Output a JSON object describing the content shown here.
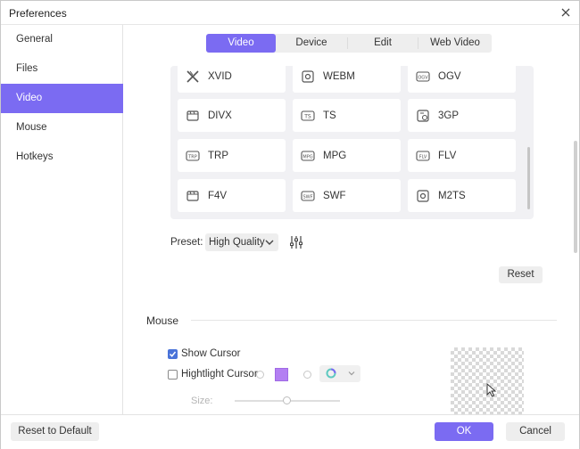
{
  "window": {
    "title": "Preferences"
  },
  "sidebar": {
    "items": [
      {
        "label": "General"
      },
      {
        "label": "Files"
      },
      {
        "label": "Video"
      },
      {
        "label": "Mouse"
      },
      {
        "label": "Hotkeys"
      }
    ],
    "active": "Video"
  },
  "tabs": {
    "items": [
      {
        "label": "Video"
      },
      {
        "label": "Device"
      },
      {
        "label": "Edit"
      },
      {
        "label": "Web Video"
      }
    ],
    "active": "Video"
  },
  "formats": [
    {
      "label": "XVID",
      "icon": "xvid-icon"
    },
    {
      "label": "WEBM",
      "icon": "webm-icon"
    },
    {
      "label": "OGV",
      "icon": "ogv-icon"
    },
    {
      "label": "DIVX",
      "icon": "divx-icon"
    },
    {
      "label": "TS",
      "icon": "ts-icon"
    },
    {
      "label": "3GP",
      "icon": "3gp-icon"
    },
    {
      "label": "TRP",
      "icon": "trp-icon"
    },
    {
      "label": "MPG",
      "icon": "mpg-icon"
    },
    {
      "label": "FLV",
      "icon": "flv-icon"
    },
    {
      "label": "F4V",
      "icon": "f4v-icon"
    },
    {
      "label": "SWF",
      "icon": "swf-icon"
    },
    {
      "label": "M2TS",
      "icon": "m2ts-icon"
    }
  ],
  "preset": {
    "label": "Preset:",
    "value": "High Quality"
  },
  "reset_label": "Reset",
  "mouse": {
    "section_title": "Mouse",
    "show_cursor": {
      "label": "Show Cursor",
      "checked": true
    },
    "highlight_cursor": {
      "label": "Hightlight Cursor:",
      "checked": false
    },
    "highlight_color": "#b37ff2",
    "size_label": "Size:"
  },
  "footer": {
    "reset_default_label": "Reset to Default",
    "ok_label": "OK",
    "cancel_label": "Cancel"
  },
  "colors": {
    "accent": "#7b6bf2",
    "checkbox": "#4a73d9"
  }
}
